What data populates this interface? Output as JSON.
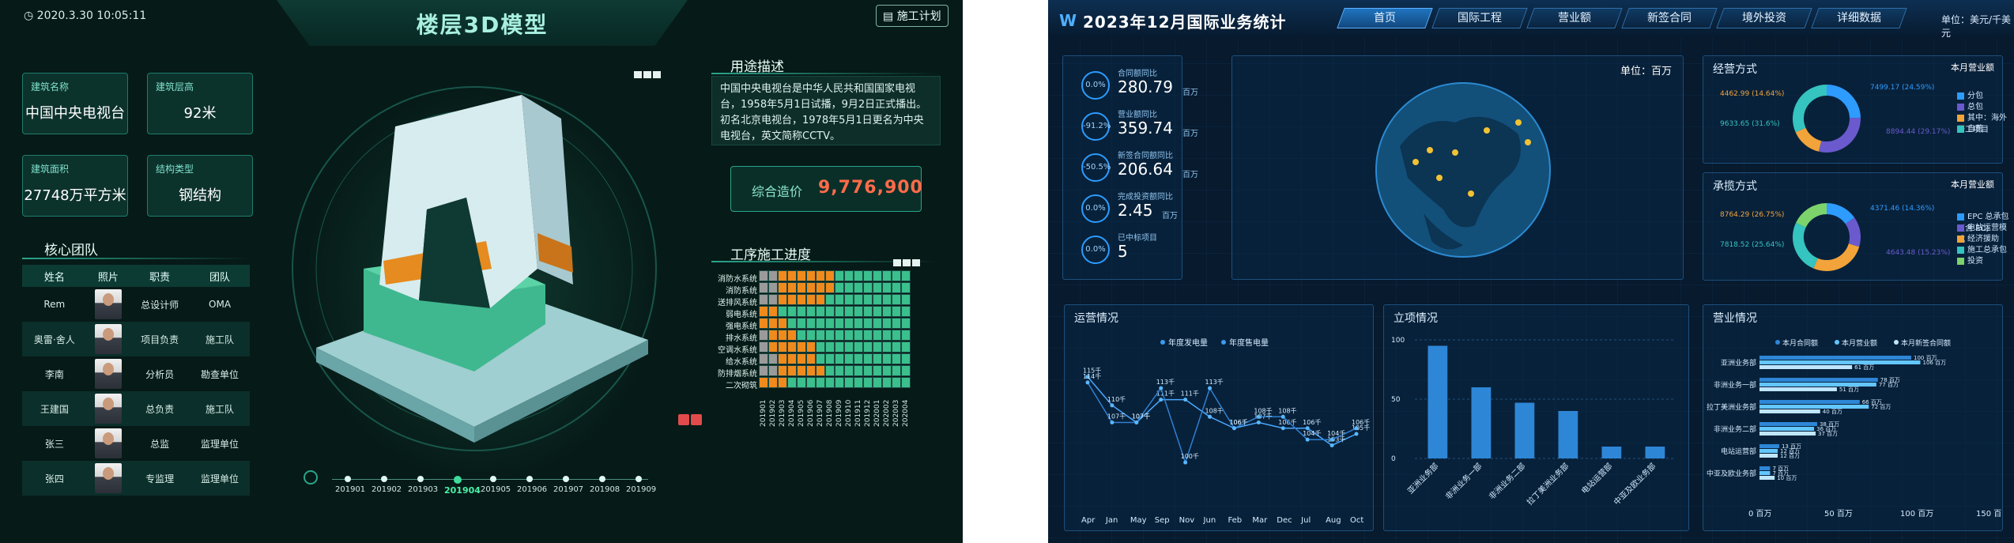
{
  "left": {
    "datetime": "2020.3.30 10:05:11",
    "title": "楼层3D模型",
    "plan_button": "施工计划",
    "cards": [
      {
        "label": "建筑名称",
        "value": "中国中央电视台"
      },
      {
        "label": "建筑层高",
        "value": "92米"
      },
      {
        "label": "建筑面积",
        "value": "27748万平方米"
      },
      {
        "label": "结构类型",
        "value": "钢结构"
      }
    ],
    "team": {
      "title": "核心团队",
      "headers": [
        "姓名",
        "照片",
        "职责",
        "团队"
      ],
      "rows": [
        [
          "Rem",
          "总设计师",
          "OMA"
        ],
        [
          "奥雷·舍人",
          "项目负责",
          "施工队"
        ],
        [
          "李南",
          "分析员",
          "勘查单位"
        ],
        [
          "王建国",
          "总负责",
          "施工队"
        ],
        [
          "张三",
          "总监",
          "监理单位"
        ],
        [
          "张四",
          "专监理",
          "监理单位"
        ]
      ]
    },
    "usage": {
      "title": "用途描述",
      "text": "中国中央电视台是中华人民共和国国家电视台，1958年5月1日试播，9月2日正式播出。初名北京电视台，1978年5月1日更名为中央电视台，英文简称CCTV。"
    },
    "cost": {
      "label": "综合造价",
      "value": "9,776,900"
    },
    "progress": {
      "title": "工序施工进度",
      "systems": [
        "消防水系统",
        "消防系统",
        "送排风系统",
        "弱电系统",
        "强电系统",
        "排水系统",
        "空调水系统",
        "给水系统",
        "防排烟系统",
        "二次砌筑"
      ],
      "dates": [
        "201901",
        "201902",
        "201903",
        "201904",
        "201905",
        "201906",
        "201907",
        "201908",
        "201909",
        "201910",
        "201911",
        "201912",
        "202001",
        "202002",
        "202003",
        "202004"
      ],
      "grey": [
        2,
        2,
        2,
        0,
        0,
        1,
        1,
        2,
        2,
        0
      ],
      "orange": [
        6,
        6,
        5,
        2,
        3,
        3,
        5,
        4,
        5,
        3
      ],
      "colors": {
        "grey": "#9a9a9a",
        "orange": "#f08a1c",
        "green": "#3bbf8d"
      }
    },
    "timeline": {
      "labels": [
        "201901",
        "201902",
        "201903",
        "201904",
        "201905",
        "201906",
        "201907",
        "201908",
        "201909"
      ],
      "active": "201904"
    }
  },
  "right": {
    "title": "2023年12月国际业务统计",
    "logo": "W",
    "nav": [
      "首页",
      "国际工程",
      "营业额",
      "新签合同",
      "境外投资",
      "详细数据"
    ],
    "unit_top": "单位：美元/千美元",
    "kpis": [
      {
        "ring": "0.0%",
        "label": "合同额同比",
        "value": "280.79",
        "unit": "百万"
      },
      {
        "ring": "-91.2%",
        "label": "营业额同比",
        "value": "359.74",
        "unit": "百万"
      },
      {
        "ring": "-50.5%",
        "label": "新签合同额同比",
        "value": "206.64",
        "unit": "百万"
      },
      {
        "ring": "0.0%",
        "label": "完成投资额同比",
        "value": "2.45",
        "unit": "百万"
      },
      {
        "ring": "0.0%",
        "label": "已中标项目",
        "value": "5",
        "unit": ""
      }
    ],
    "map": {
      "unit": "单位：百万"
    },
    "operate_mode": {
      "title": "经营方式",
      "period": "本月营业额",
      "legend": [
        "分包",
        "总包",
        "其中：海外开工项目",
        "自营"
      ],
      "colors": [
        "#2e9bff",
        "#6a5acd",
        "#f2a33a",
        "#35c4c0"
      ],
      "values": [
        24.59,
        29.17,
        14.64,
        31.6
      ],
      "callouts": [
        "7499.17 (24.59%)",
        "8894.44 (29.17%)",
        "4462.99 (14.64%)",
        "9633.65 (31.6%)"
      ]
    },
    "contract_mode": {
      "title": "承揽方式",
      "period": "本月营业额",
      "legend": [
        "EPC 总承包（含 EC)",
        "电站运营模式",
        "经济援助",
        "施工总承包",
        "投资"
      ],
      "colors": [
        "#2e9bff",
        "#6a5acd",
        "#f2a33a",
        "#35c4c0",
        "#7cd36b"
      ],
      "values": [
        15.23,
        14.36,
        26.75,
        25.64,
        18.02
      ],
      "callouts": [
        "4371.46 (14.36%)",
        "4643.48 (15.23%)",
        "8764.29 (26.75%)",
        "7818.52 (25.64%)"
      ]
    },
    "ops_chart": {
      "title": "运营情况",
      "legend": [
        "年度发电量",
        "年度售电量"
      ],
      "months": [
        "Apr",
        "Jan",
        "May",
        "Sep",
        "Nov",
        "Jun",
        "Feb",
        "Mar",
        "Dec",
        "Jul",
        "Aug",
        "Oct"
      ],
      "series_a": [
        115,
        110,
        107,
        111,
        111,
        108,
        106,
        107,
        106,
        106,
        103,
        105
      ],
      "series_b": [
        114,
        107,
        107,
        113,
        100,
        113,
        106,
        108,
        108,
        104,
        104,
        106
      ],
      "ylim": [
        0,
        120
      ]
    },
    "bid_chart": {
      "title": "立项情况",
      "categories": [
        "亚洲业务部",
        "非洲业务一部",
        "非洲业务二部",
        "拉丁美洲业务部",
        "电站运营部",
        "中亚及欧业务部"
      ],
      "values": [
        95,
        60,
        47,
        40,
        10,
        10
      ],
      "yticks": [
        "100",
        "50",
        "0"
      ],
      "color": "#2e86d6"
    },
    "revenue_chart": {
      "title": "营业情况",
      "legend": [
        "本月合同额",
        "本月营业额",
        "本月新签合同额"
      ],
      "categories": [
        "亚洲业务部",
        "非洲业务一部",
        "拉丁美洲业务部",
        "非洲业务二部",
        "电站运营部",
        "中亚及欧业务部"
      ],
      "series": [
        {
          "name": "本月合同额",
          "values": [
            100,
            78,
            66,
            38,
            13,
            7
          ]
        },
        {
          "name": "本月营业额",
          "values": [
            106,
            77,
            72,
            36,
            12,
            7
          ]
        },
        {
          "name": "本月新签合同额",
          "values": [
            61,
            51,
            40,
            37,
            12,
            10
          ]
        }
      ],
      "xticks": [
        "0 百万",
        "50 百万",
        "100 百万",
        "150 百万"
      ],
      "colors": [
        "#2e86d6",
        "#63c6ff",
        "#bfe6ff"
      ]
    }
  }
}
